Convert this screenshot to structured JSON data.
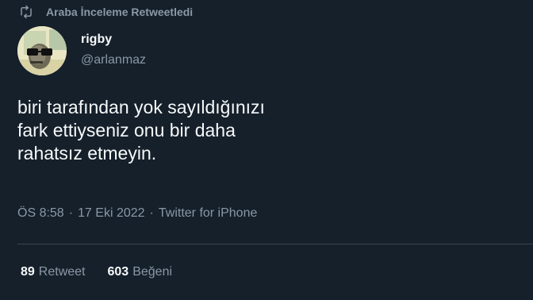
{
  "retweet_context": {
    "icon": "retweet-icon",
    "text": "Araba İnceleme Retweetledi"
  },
  "author": {
    "display_name": "rigby",
    "handle": "@arlanmaz"
  },
  "tweet": {
    "text": "biri tarafından yok sayıldığınızı\nfark ettiyseniz onu bir daha\nrahatsız etmeyin."
  },
  "meta": {
    "time": "ÖS 8:58",
    "separator": "·",
    "date": "17 Eki 2022",
    "source": "Twitter for iPhone"
  },
  "stats": {
    "retweets_count": "89",
    "retweets_label": "Retweet",
    "likes_count": "603",
    "likes_label": "Beğeni"
  },
  "colors": {
    "background": "#15202b",
    "primary_text": "#f7f9f9",
    "secondary_text": "#8b98a5",
    "divider": "#38444d"
  }
}
